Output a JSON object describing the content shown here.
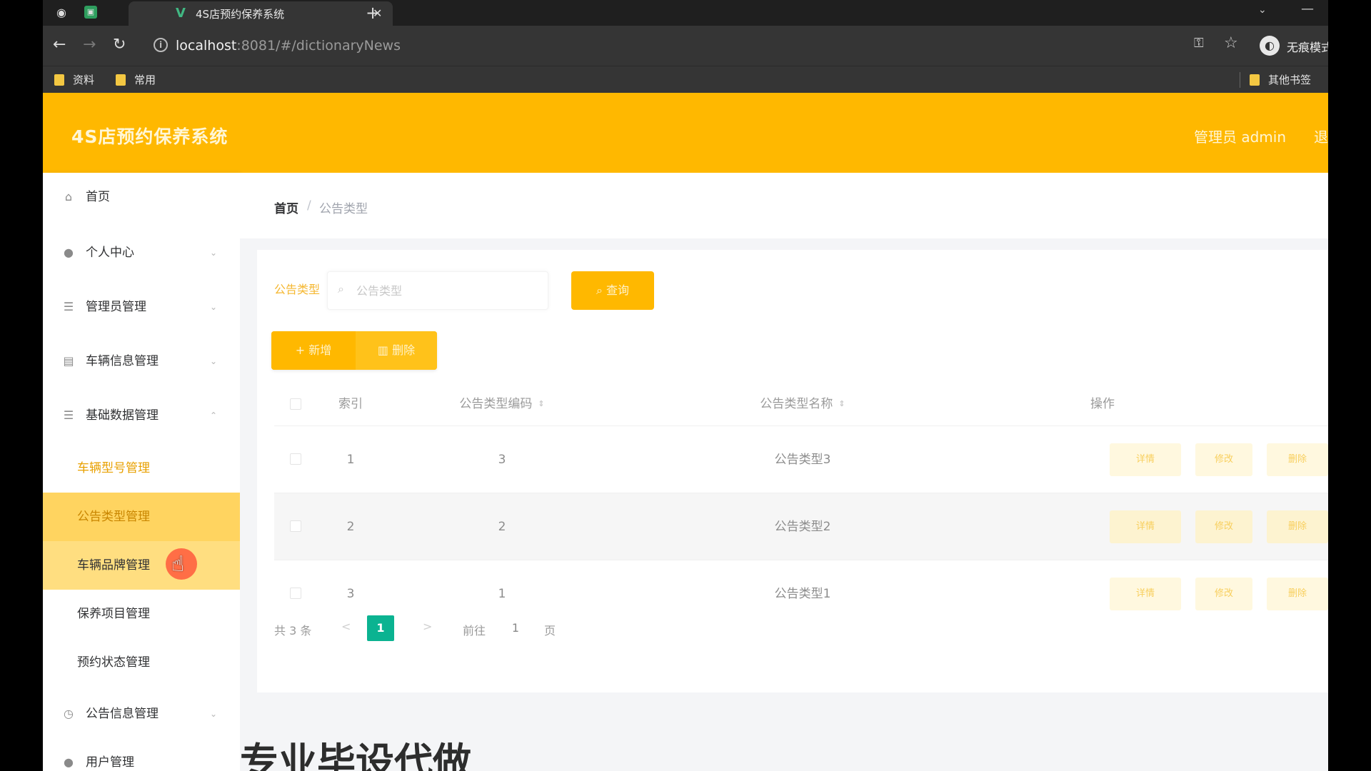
{
  "browser": {
    "tab_title": "4S店预约保养系统",
    "url_host": "localhost",
    "url_path": ":8081/#/dictionaryNews",
    "profile_label": "无痕模式",
    "bookmarks": [
      "资料",
      "常用",
      "其他书签"
    ]
  },
  "app": {
    "title": "4S店预约保养系统",
    "user": "管理员 admin",
    "exit": "退"
  },
  "sidebar": {
    "items": [
      {
        "label": "首页",
        "icon": "home-icon"
      },
      {
        "label": "个人中心",
        "icon": "user-icon"
      },
      {
        "label": "管理员管理",
        "icon": "list-icon"
      },
      {
        "label": "车辆信息管理",
        "icon": "clipboard-icon"
      },
      {
        "label": "基础数据管理",
        "icon": "list-icon"
      }
    ],
    "sub_items": [
      "车辆型号管理",
      "公告类型管理",
      "车辆品牌管理",
      "保养项目管理",
      "预约状态管理"
    ],
    "more_items": [
      {
        "label": "公告信息管理",
        "icon": "clock-icon"
      },
      {
        "label": "用户管理",
        "icon": "user-icon"
      }
    ]
  },
  "breadcrumb": {
    "home": "首页",
    "separator": "/",
    "current": "公告类型"
  },
  "search": {
    "label": "公告类型",
    "placeholder": "公告类型",
    "query_label": "查询"
  },
  "actions": {
    "add_label": "新增",
    "delete_label": "删除"
  },
  "table": {
    "headers": [
      "索引",
      "公告类型编码",
      "公告类型名称",
      "操作"
    ],
    "rows": [
      {
        "index": "1",
        "code": "3",
        "name": "公告类型3"
      },
      {
        "index": "2",
        "code": "2",
        "name": "公告类型2"
      },
      {
        "index": "3",
        "code": "1",
        "name": "公告类型1"
      }
    ],
    "row_actions": [
      "详情",
      "修改",
      "删除"
    ]
  },
  "pagination": {
    "total": "共 3 条",
    "prev": "<",
    "current": "1",
    "next": ">",
    "goto": "前往",
    "goto_value": "1",
    "page_unit": "页"
  },
  "watermark": "专业毕设代做",
  "colors": {
    "header": "#ffb800",
    "active_menu": "#ffd460",
    "pager_active": "#0bb391"
  }
}
